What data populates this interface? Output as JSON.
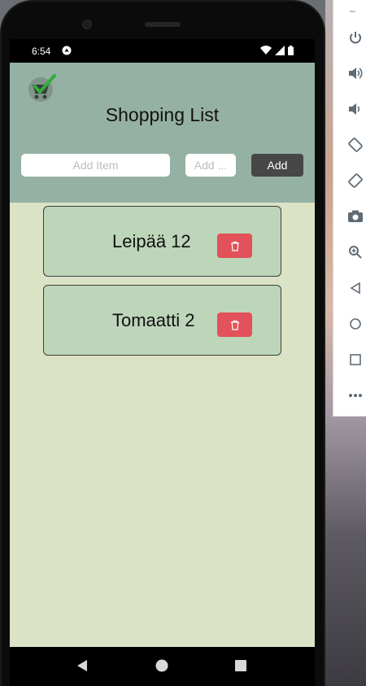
{
  "status_bar": {
    "time": "6:54"
  },
  "app": {
    "title": "Shopping List",
    "logo_icon": "shopping-cart-check-icon"
  },
  "form": {
    "item_placeholder": "Add Item",
    "quantity_placeholder": "Add ...",
    "add_label": "Add"
  },
  "items": [
    {
      "text": "Leipää 12"
    },
    {
      "text": "Tomaatti 2"
    }
  ],
  "colors": {
    "header_bg": "#95b1a3",
    "content_bg": "#dbe3c7",
    "card_bg": "#bdd6b9",
    "delete_button": "#e3515a",
    "add_button": "#474747"
  },
  "emulator_toolbar": {
    "icons": [
      "power-icon",
      "volume-up-icon",
      "volume-down-icon",
      "rotate-left-icon",
      "rotate-right-icon",
      "camera-icon",
      "zoom-icon",
      "back-icon",
      "home-icon",
      "overview-icon",
      "more-icon"
    ]
  }
}
